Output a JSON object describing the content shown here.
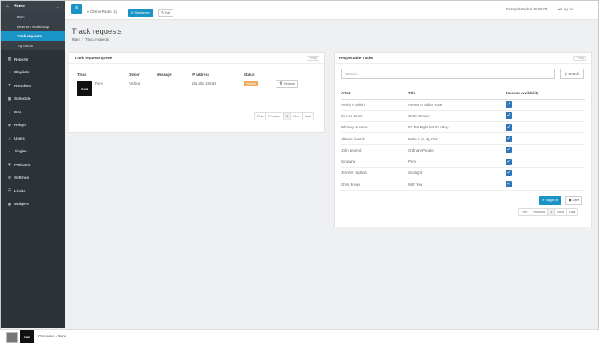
{
  "sidebar": {
    "home_label": "Home",
    "sub_items": [
      "Main",
      "Listeners World map",
      "Track requests",
      "Top tracks"
    ],
    "active_index": 2,
    "items": [
      {
        "label": "Reports",
        "icon": "bar-chart-icon"
      },
      {
        "label": "Playlists",
        "icon": "playlist-icon"
      },
      {
        "label": "Rotations",
        "icon": "rotation-icon"
      },
      {
        "label": "Schedule",
        "icon": "calendar-icon"
      },
      {
        "label": "DJs",
        "icon": "microphone-icon"
      },
      {
        "label": "Relays",
        "icon": "relay-icon"
      },
      {
        "label": "Users",
        "icon": "users-icon"
      },
      {
        "label": "Jingles",
        "icon": "speaker-icon"
      },
      {
        "label": "Podcasts",
        "icon": "podcast-icon"
      },
      {
        "label": "Settings",
        "icon": "settings-icon"
      },
      {
        "label": "Limits",
        "icon": "limits-icon"
      },
      {
        "label": "Widgets",
        "icon": "widgets-icon"
      }
    ]
  },
  "topbar": {
    "radio_selector": "Online Radio (1)",
    "stat_button": "Stat server",
    "edit_button": "Edit",
    "timezone": "Europe/Istanbul 05:00:08",
    "logout": "Log out"
  },
  "page": {
    "title": "Track requests",
    "breadcrumb_main": "Main",
    "breadcrumb_current": "Track requests"
  },
  "queue": {
    "title": "Track requests queue",
    "help": "? Help",
    "columns": [
      "Track",
      "Owner",
      "Message",
      "IP address",
      "Status"
    ],
    "rows": [
      {
        "track": "Pony",
        "art": "R&B",
        "owner": "Andrea",
        "message": "",
        "ip": "151.250.195.83",
        "status": "Viewed",
        "action": "Remove"
      }
    ],
    "pager": [
      "First",
      "Previous",
      "1",
      "Next",
      "Last"
    ]
  },
  "tracks": {
    "title": "Requestable tracks",
    "help": "? Help",
    "search_placeholder": "Search...",
    "search_button": "Search",
    "columns": [
      "Artist",
      "Title",
      "Jukebox availability"
    ],
    "rows": [
      {
        "artist": "Aretha Franklin",
        "title": "A Rose Is Still a Rose",
        "available": true
      },
      {
        "artist": "Cee-Lo Green",
        "title": "Gettin' Grown",
        "available": true
      },
      {
        "artist": "Whitney Houston",
        "title": "It's Not Right but It's Okay",
        "available": true
      },
      {
        "artist": "Alleen Limerick",
        "title": "Make It on My Own",
        "available": true
      },
      {
        "artist": "John Legend",
        "title": "Ordinary People",
        "available": true
      },
      {
        "artist": "Ginuwine",
        "title": "Pony",
        "available": true
      },
      {
        "artist": "Jennifer Hudson",
        "title": "Spotlight",
        "available": true
      },
      {
        "artist": "Chris Brown",
        "title": "With You",
        "available": true
      }
    ],
    "toggle_button": "Toggle all",
    "save_button": "Save",
    "pager": [
      "First",
      "Previous",
      "1",
      "Next",
      "Last"
    ]
  },
  "player": {
    "now_playing": "Ginuwine - Pony",
    "art": "R&B"
  },
  "colors": {
    "accent": "#1a94c6",
    "sidebar": "#2d3238",
    "badge": "#f0a95c",
    "checkbox": "#2f76b8"
  }
}
